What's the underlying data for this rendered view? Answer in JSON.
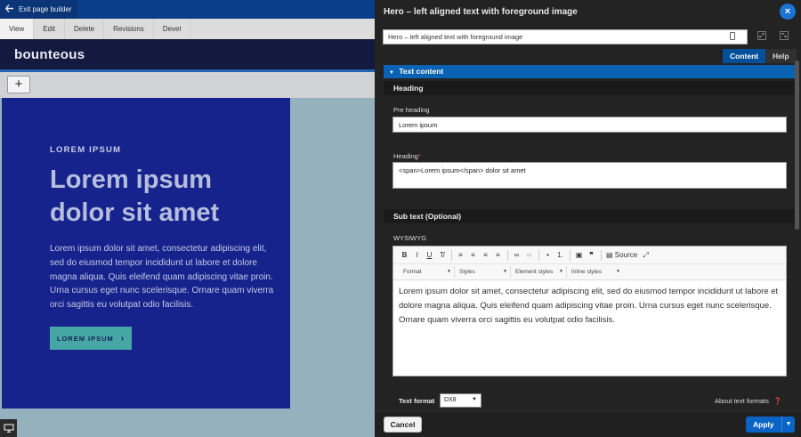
{
  "toolbar": {
    "exit_label": "Exit page builder",
    "tabs": [
      "View",
      "Edit",
      "Delete",
      "Revisions",
      "Devel"
    ]
  },
  "brand": {
    "logo": "bounteous"
  },
  "add_button": "+",
  "hero": {
    "pre_heading": "LOREM IPSUM",
    "heading": "Lorem ipsum dolor sit amet",
    "body": "Lorem ipsum dolor sit amet, consectetur adipiscing elit, sed do eiusmod tempor incididunt ut labore et dolore magna aliqua. Quis eleifend quam adipiscing vitae proin. Urna cursus eget nunc scelerisque. Ornare quam viverra orci sagittis eu volutpat odio facilisis.",
    "cta_label": "LOREM IPSUM",
    "cta_arrow": "›",
    "colors": {
      "panel": "#16238c",
      "cta": "#46a6a4",
      "backdrop": "#94b1bd"
    }
  },
  "dialog": {
    "title": "Hero – left aligned text with foreground image",
    "close_icon": "×",
    "title_input_value": "Hero – left aligned text with foreground image",
    "tab_content": "Content",
    "tab_help": "Help",
    "section_label": "Text content",
    "heading_group": "Heading",
    "pre_heading_label": "Pre heading",
    "pre_heading_value": "Lorem ipsum",
    "heading_label": "Heading",
    "heading_required": "*",
    "heading_value": "<span>Lorem ipsum</span> dolor sit amet",
    "subtext_group": "Sub text (Optional)",
    "wysiwyg_label": "WYSIWYG",
    "editor": {
      "format_label": "Format",
      "styles_label": "Styles",
      "element_styles_label": "Element styles",
      "inline_styles_label": "Inline styles",
      "source_label": "Source",
      "content": "Lorem ipsum dolor sit amet, consectetur adipiscing elit, sed do eiusmod tempor incididunt ut labore et dolore magna aliqua. Quis eleifend quam adipiscing vitae proin. Urna cursus eget nunc scelerisque. Ornare quam viverra orci sagittis eu volutpat odio facilisis."
    },
    "text_format_label": "Text format",
    "text_format_value": "DX8",
    "about_formats": "About text formats",
    "cancel_label": "Cancel",
    "apply_label": "Apply",
    "accent_color": "#0a62b4"
  }
}
